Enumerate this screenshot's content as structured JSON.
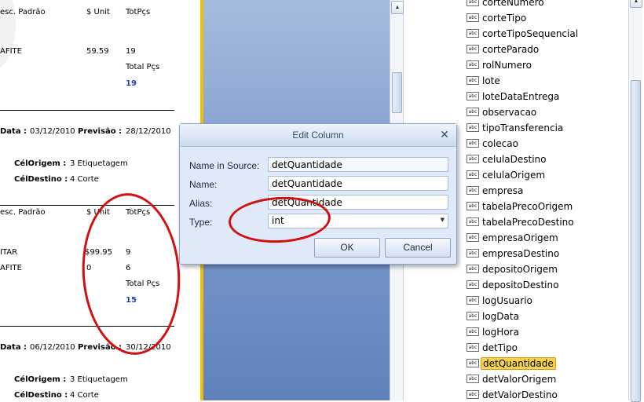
{
  "report": {
    "section1": {
      "h_desc": "esc. Padrão",
      "h_unit": "$ Unit",
      "h_tot": "TotPçs",
      "item1_desc": "AFITE",
      "item1_unit": "59.59",
      "item1_qty": "19",
      "total_label": "Total Pçs",
      "total_value": "19"
    },
    "block1": {
      "data_label": "Data :",
      "data_value": "03/12/2010",
      "previsao_label": "Previsão :",
      "previsao_value": "28/12/2010",
      "origem_label": "CélOrigem :",
      "origem_value": "3 Etiquetagem",
      "destino_label": "CélDestino :",
      "destino_value": "4 Corte"
    },
    "section2": {
      "h_desc": "esc. Padrão",
      "h_unit": "$ Unit",
      "h_tot": "TotPçs",
      "item1_desc": "ITAR",
      "item1_unit": "$99.95",
      "item1_qty": "9",
      "item2_desc": "AFITE",
      "item2_unit": "0",
      "item2_qty": "6",
      "total_label": "Total Pçs",
      "total_value": "15"
    },
    "block2": {
      "data_label": "Data :",
      "data_value": "06/12/2010",
      "previsao_label": "Previsão :",
      "previsao_value": "30/12/2010",
      "origem_label": "CélOrigem :",
      "origem_value": "3 Etiquetagem",
      "destino_label": "CélDestino :",
      "destino_value": "4 Corte"
    }
  },
  "scroll": {
    "up_glyph": "▲"
  },
  "fields": {
    "icon_text": "abc",
    "items": [
      {
        "label": "corteNumero",
        "selected": false
      },
      {
        "label": "corteTipo",
        "selected": false
      },
      {
        "label": "corteTipoSequencial",
        "selected": false
      },
      {
        "label": "corteParado",
        "selected": false
      },
      {
        "label": "rolNumero",
        "selected": false
      },
      {
        "label": "lote",
        "selected": false
      },
      {
        "label": "loteDataEntrega",
        "selected": false
      },
      {
        "label": "observacao",
        "selected": false
      },
      {
        "label": "tipoTransferencia",
        "selected": false
      },
      {
        "label": "colecao",
        "selected": false
      },
      {
        "label": "celulaDestino",
        "selected": false
      },
      {
        "label": "celulaOrigem",
        "selected": false
      },
      {
        "label": "empresa",
        "selected": false
      },
      {
        "label": "tabelaPrecoOrigem",
        "selected": false
      },
      {
        "label": "tabelaPrecoDestino",
        "selected": false
      },
      {
        "label": "empresaOrigem",
        "selected": false
      },
      {
        "label": "empresaDestino",
        "selected": false
      },
      {
        "label": "depositoOrigem",
        "selected": false
      },
      {
        "label": "depositoDestino",
        "selected": false
      },
      {
        "label": "logUsuario",
        "selected": false
      },
      {
        "label": "logData",
        "selected": false
      },
      {
        "label": "logHora",
        "selected": false
      },
      {
        "label": "detTipo",
        "selected": false
      },
      {
        "label": "detQuantidade",
        "selected": true
      },
      {
        "label": "detValorOrigem",
        "selected": false
      },
      {
        "label": "detValorDestino",
        "selected": false
      }
    ]
  },
  "dialog": {
    "title": "Edit Column",
    "close_glyph": "✕",
    "name_in_source_label": "Name in Source:",
    "name_in_source_value": "detQuantidade",
    "name_label": "Name:",
    "name_value": "detQuantidade",
    "alias_label": "Alias:",
    "alias_value": "detQuantidade",
    "type_label": "Type:",
    "type_value": "int",
    "type_arrow": "▼",
    "ok_label": "OK",
    "cancel_label": "Cancel"
  },
  "colors": {
    "annotation_red": "#d21010",
    "selection_yellow": "#f8d44e",
    "panel_blue": "#7f9ccc"
  }
}
